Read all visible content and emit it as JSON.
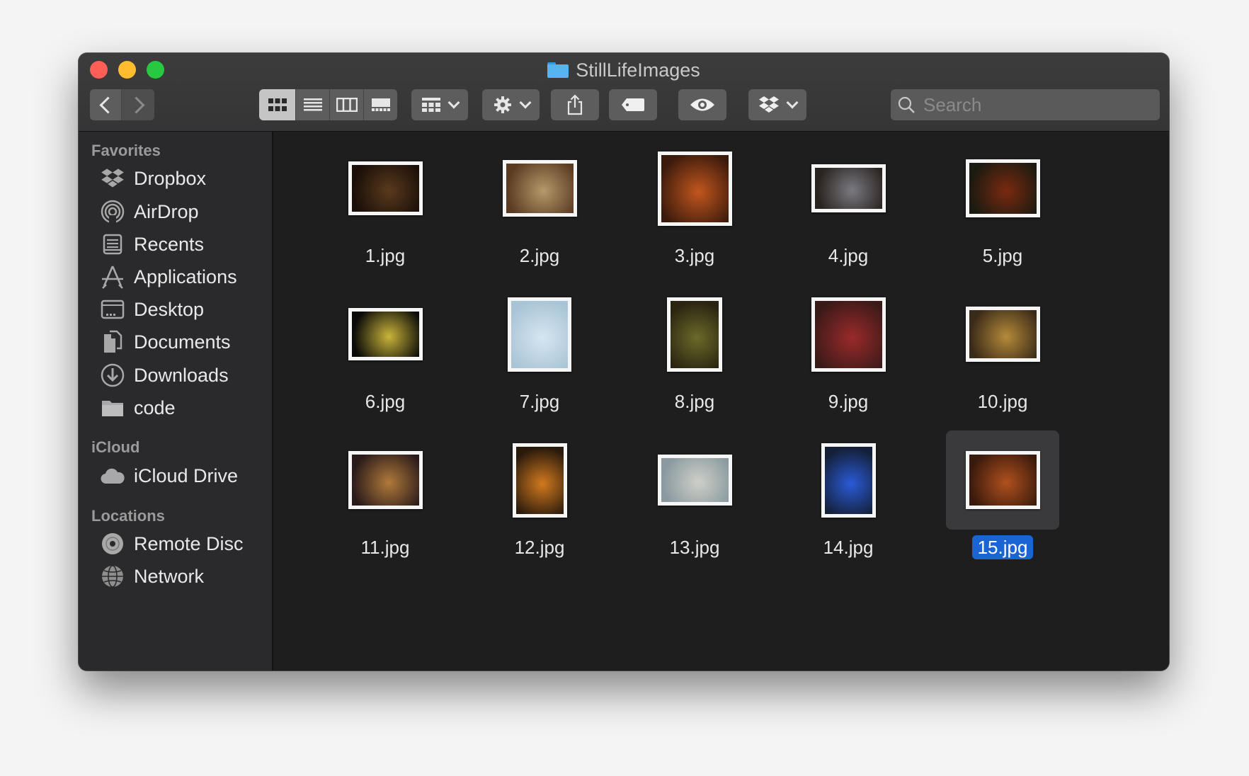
{
  "window": {
    "title": "StillLifeImages"
  },
  "toolbar": {
    "search_placeholder": "Search",
    "view_modes": [
      "icon-view",
      "list-view",
      "column-view",
      "gallery-view"
    ],
    "active_view": "icon-view"
  },
  "sidebar": {
    "favorites_title": "Favorites",
    "favorites": [
      {
        "label": "Dropbox",
        "icon": "dropbox-icon"
      },
      {
        "label": "AirDrop",
        "icon": "airdrop-icon"
      },
      {
        "label": "Recents",
        "icon": "recents-icon"
      },
      {
        "label": "Applications",
        "icon": "applications-icon"
      },
      {
        "label": "Desktop",
        "icon": "desktop-icon"
      },
      {
        "label": "Documents",
        "icon": "documents-icon"
      },
      {
        "label": "Downloads",
        "icon": "downloads-icon"
      },
      {
        "label": "code",
        "icon": "folder-icon"
      }
    ],
    "icloud_title": "iCloud",
    "icloud": [
      {
        "label": "iCloud Drive",
        "icon": "cloud-icon"
      }
    ],
    "locations_title": "Locations",
    "locations": [
      {
        "label": "Remote Disc",
        "icon": "disc-icon"
      },
      {
        "label": "Network",
        "icon": "network-icon"
      }
    ]
  },
  "files": [
    {
      "name": "1.jpg",
      "colors": [
        "#5a3a1e",
        "#1a0f08"
      ]
    },
    {
      "name": "2.jpg",
      "colors": [
        "#b59a6a",
        "#5b3a22"
      ]
    },
    {
      "name": "3.jpg",
      "colors": [
        "#c2561e",
        "#3a1a0c"
      ]
    },
    {
      "name": "4.jpg",
      "colors": [
        "#7a7a82",
        "#2a2420"
      ]
    },
    {
      "name": "5.jpg",
      "colors": [
        "#7a2a10",
        "#1a1a10"
      ]
    },
    {
      "name": "6.jpg",
      "colors": [
        "#c9b43a",
        "#0a0a08"
      ]
    },
    {
      "name": "7.jpg",
      "colors": [
        "#d6e6f0",
        "#a8c4d6"
      ]
    },
    {
      "name": "8.jpg",
      "colors": [
        "#6b6a2a",
        "#2a2410"
      ]
    },
    {
      "name": "9.jpg",
      "colors": [
        "#9a2a2a",
        "#3a1a18"
      ]
    },
    {
      "name": "10.jpg",
      "colors": [
        "#b58a3a",
        "#3a2a18"
      ]
    },
    {
      "name": "11.jpg",
      "colors": [
        "#b07a3a",
        "#2a1a1a"
      ]
    },
    {
      "name": "12.jpg",
      "colors": [
        "#d27a1e",
        "#2a1a0c"
      ]
    },
    {
      "name": "13.jpg",
      "colors": [
        "#cfcfc8",
        "#8a9aa0"
      ]
    },
    {
      "name": "14.jpg",
      "colors": [
        "#2a5ad6",
        "#142038"
      ]
    },
    {
      "name": "15.jpg",
      "colors": [
        "#b0501e",
        "#3a1a0c"
      ]
    }
  ],
  "selected_file": "15.jpg"
}
